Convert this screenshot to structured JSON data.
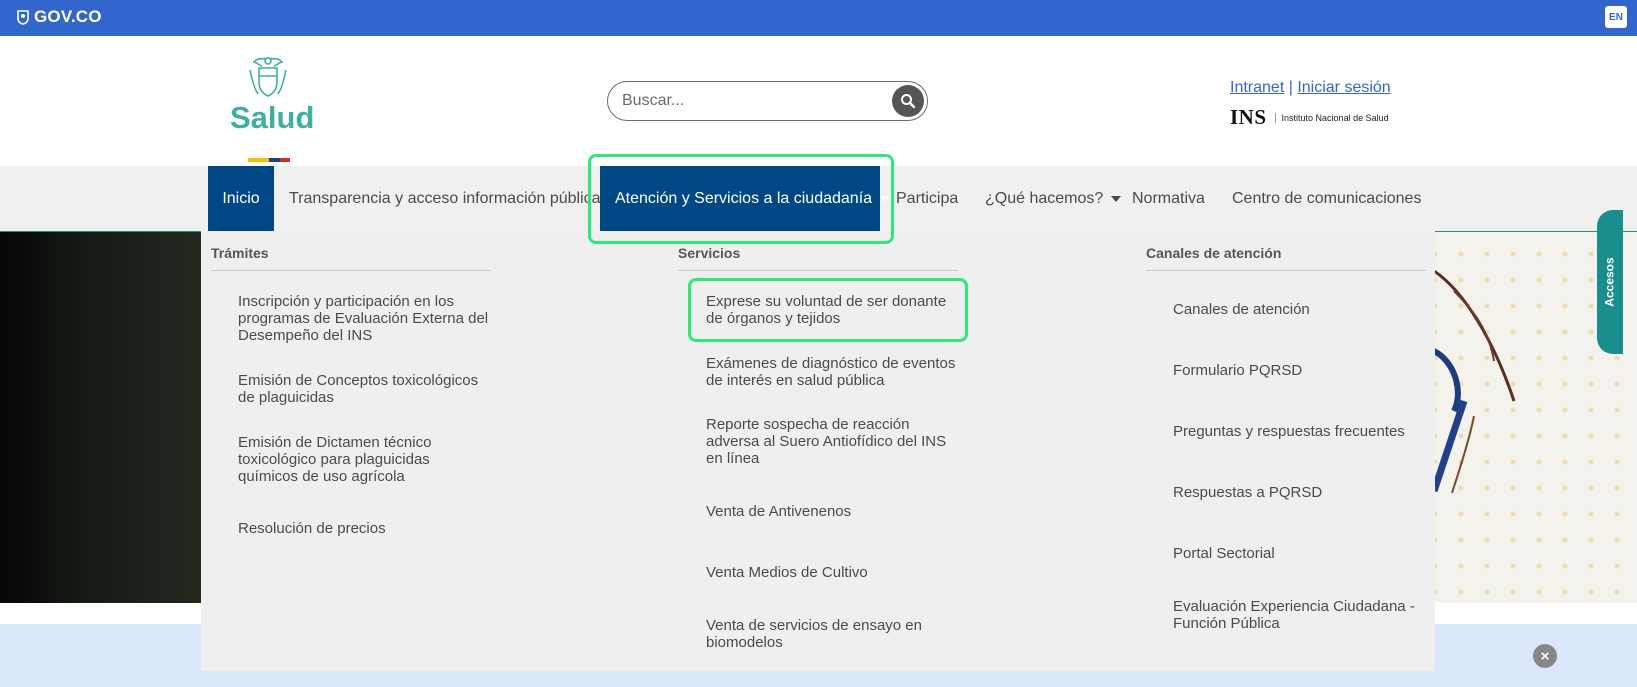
{
  "gov_bar": {
    "brand": "GOV.CO",
    "language": "EN"
  },
  "header": {
    "logo_text": "Salud",
    "search_placeholder": "Buscar...",
    "links": {
      "intranet": "Intranet",
      "separator": "|",
      "login": "Iniciar sesión"
    },
    "ins_logo": {
      "mark": "INS",
      "name": "Instituto Nacional de Salud"
    }
  },
  "nav": {
    "items": [
      {
        "label": "Inicio"
      },
      {
        "label": "Transparencia y acceso información pública"
      },
      {
        "label": "Atención y Servicios a la ciudadanía"
      },
      {
        "label": "Participa"
      },
      {
        "label": "¿Qué hacemos?"
      },
      {
        "label": "Normativa"
      },
      {
        "label": "Centro de comunicaciones"
      }
    ]
  },
  "menu": {
    "tramites": {
      "heading": "Trámites",
      "items": [
        "Inscripción y participación en los programas de Evaluación Externa del Desempeño del INS",
        "Emisión de Conceptos toxicológicos de plaguicidas",
        "Emisión de Dictamen técnico toxicológico para plaguicidas químicos de uso agrícola",
        "Resolución de precios"
      ]
    },
    "servicios": {
      "heading": "Servicios",
      "items": [
        "Exprese su voluntad de ser donante de órganos y tejidos",
        "Exámenes de diagnóstico de eventos de interés en salud pública",
        "Reporte sospecha de reacción adversa al Suero Antiofídico del INS en línea",
        "Venta de Antivenenos",
        "Venta Medios de Cultivo",
        "Venta de servicios de ensayo en biomodelos"
      ]
    },
    "canales": {
      "heading": "Canales de atención",
      "items": [
        "Canales de atención",
        "Formulario PQRSD",
        "Preguntas y respuestas frecuentes",
        "Respuestas a PQRSD",
        "Portal Sectorial",
        "Evaluación Experiencia Ciudadana - Función Pública"
      ]
    }
  },
  "side_tab": {
    "label": "Accesos"
  },
  "colors": {
    "gov_blue": "#3366cc",
    "nav_active": "#004884",
    "highlight": "#2bea79",
    "salud_green": "#3eb0a2"
  }
}
